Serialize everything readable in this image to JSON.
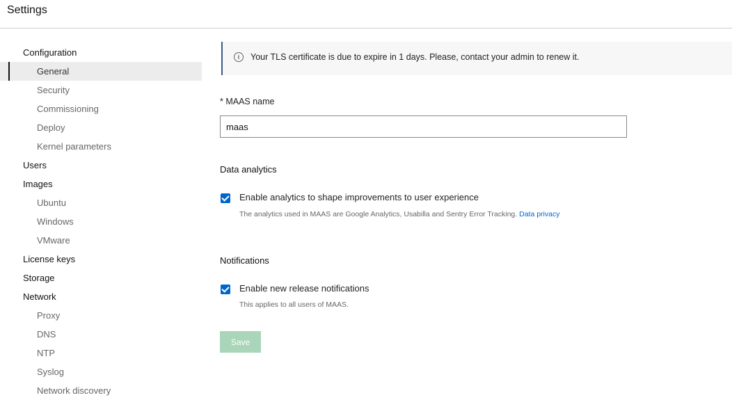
{
  "header": {
    "title": "Settings"
  },
  "sidebar": {
    "configuration": "Configuration",
    "configuration_items": [
      "General",
      "Security",
      "Commissioning",
      "Deploy",
      "Kernel parameters"
    ],
    "users": "Users",
    "images": "Images",
    "images_items": [
      "Ubuntu",
      "Windows",
      "VMware"
    ],
    "license_keys": "License keys",
    "storage": "Storage",
    "network": "Network",
    "network_items": [
      "Proxy",
      "DNS",
      "NTP",
      "Syslog",
      "Network discovery"
    ]
  },
  "notice": {
    "icon": "info-icon",
    "text": "Your TLS certificate is due to expire in 1 days. Please, contact your admin to renew it."
  },
  "form": {
    "maas_name_label": "* MAAS name",
    "maas_name_value": "maas",
    "data_analytics_heading": "Data analytics",
    "analytics_checkbox_label": "Enable analytics to shape improvements to user experience",
    "analytics_checked": true,
    "analytics_help": "The analytics used in MAAS are Google Analytics, Usabilla and Sentry Error Tracking.",
    "analytics_link": "Data privacy",
    "notifications_heading": "Notifications",
    "notifications_checkbox_label": "Enable new release notifications",
    "notifications_checked": true,
    "notifications_help": "This applies to all users of MAAS.",
    "save_label": "Save"
  },
  "colors": {
    "accent": "#0066cc",
    "save_disabled": "#a9d5b9",
    "notice_border": "#3a5a86"
  }
}
